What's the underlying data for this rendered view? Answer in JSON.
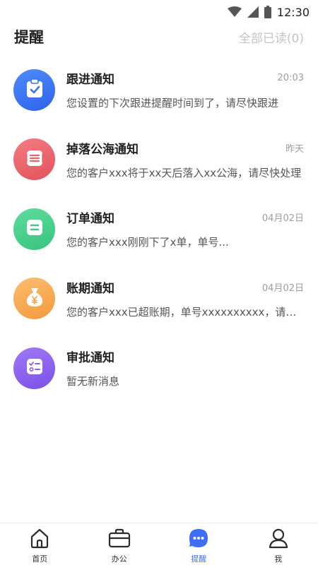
{
  "status_bar": {
    "time": "12:30"
  },
  "header": {
    "title": "提醒",
    "mark_all_read": "全部已读(0)"
  },
  "notices": [
    {
      "title": "跟进通知",
      "time": "20:03",
      "desc": "您设置的下次跟进提醒时间到了，请尽快跟进",
      "icon": "clipboard-check-icon",
      "color_from": "#4f8bff",
      "color_to": "#2e63e8"
    },
    {
      "title": "掉落公海通知",
      "time": "昨天",
      "desc": "您的客户xxx将于xx天后落入xx公海，请尽快处理",
      "icon": "stack-icon",
      "color_from": "#f47c82",
      "color_to": "#e2525c"
    },
    {
      "title": "订单通知",
      "time": "04月02日",
      "desc": "您的客户xxx刚刚下了x单，单号...",
      "icon": "document-icon",
      "color_from": "#5fdc9c",
      "color_to": "#36c47e"
    },
    {
      "title": "账期通知",
      "time": "04月02日",
      "desc": "您的客户xxx已超账期，单号xxxxxxxxxx，请尽快处理",
      "icon": "money-bag-icon",
      "color_from": "#fdbd6e",
      "color_to": "#f39a3e"
    },
    {
      "title": "审批通知",
      "time": "",
      "desc": "暂无新消息",
      "icon": "approval-list-icon",
      "color_from": "#a07af6",
      "color_to": "#7b4fe6"
    }
  ],
  "tabs": [
    {
      "label": "首页",
      "icon": "home-icon",
      "active": false
    },
    {
      "label": "办公",
      "icon": "briefcase-icon",
      "active": false
    },
    {
      "label": "提醒",
      "icon": "chat-bubble-icon",
      "active": true
    },
    {
      "label": "我",
      "icon": "user-icon",
      "active": false
    }
  ],
  "colors": {
    "accent": "#3d6ef3",
    "muted": "#9e9e9e"
  }
}
